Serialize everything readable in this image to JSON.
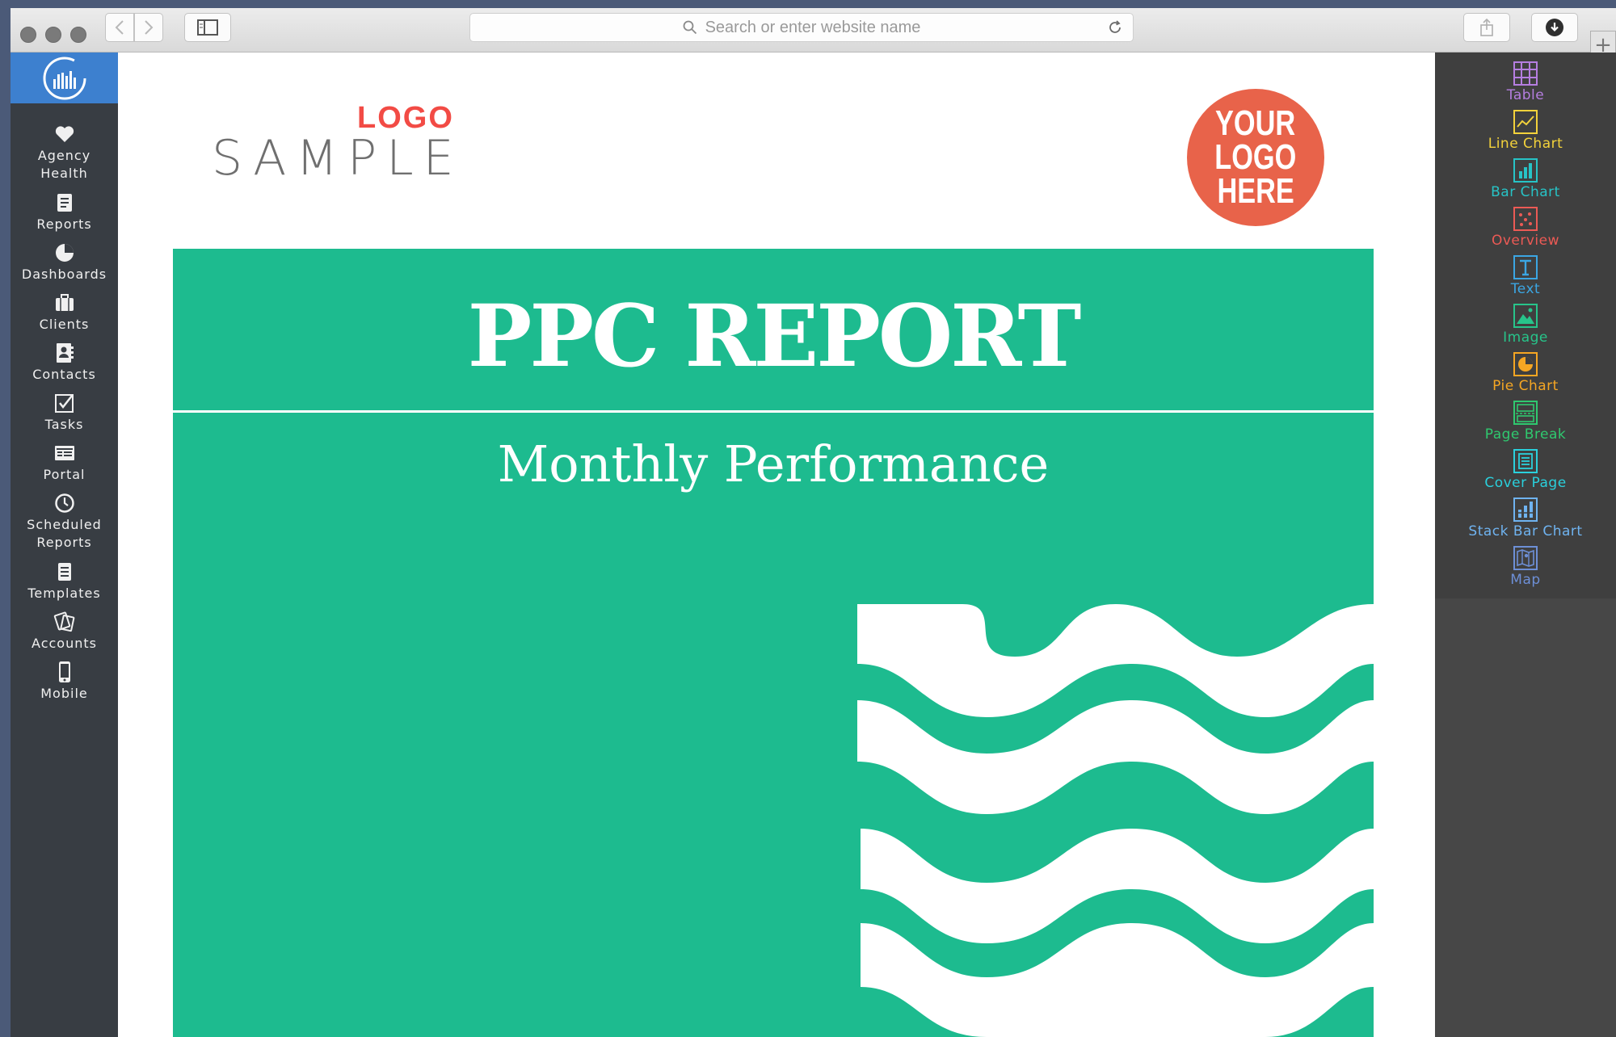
{
  "browser": {
    "address_placeholder": "Search or enter website name"
  },
  "sidebar": {
    "items": [
      {
        "label": "Agency\nHealth",
        "icon": "heart-icon"
      },
      {
        "label": "Reports",
        "icon": "reports-icon"
      },
      {
        "label": "Dashboards",
        "icon": "dashboards-icon"
      },
      {
        "label": "Clients",
        "icon": "briefcase-icon"
      },
      {
        "label": "Contacts",
        "icon": "contacts-icon"
      },
      {
        "label": "Tasks",
        "icon": "checkbox-icon"
      },
      {
        "label": "Portal",
        "icon": "portal-icon"
      },
      {
        "label": "Scheduled\nReports",
        "icon": "clock-icon"
      },
      {
        "label": "Templates",
        "icon": "templates-icon"
      },
      {
        "label": "Accounts",
        "icon": "accounts-icon"
      },
      {
        "label": "Mobile",
        "icon": "mobile-icon"
      }
    ]
  },
  "report": {
    "logo_top": "LOGO",
    "logo_bottom": "SAMPLE",
    "badge_lines": [
      "YOUR",
      "LOGO",
      "HERE"
    ],
    "title": "PPC REPORT",
    "subtitle": "Monthly Performance"
  },
  "widgets": [
    {
      "label": "Table",
      "icon": "table-icon",
      "color": "#b57ee0"
    },
    {
      "label": "Line Chart",
      "icon": "line-chart-icon",
      "color": "#f3d23b"
    },
    {
      "label": "Bar Chart",
      "icon": "bar-chart-icon",
      "color": "#27c3c6"
    },
    {
      "label": "Overview",
      "icon": "overview-icon",
      "color": "#ec5a55"
    },
    {
      "label": "Text",
      "icon": "text-icon",
      "color": "#3ba6e3"
    },
    {
      "label": "Image",
      "icon": "image-icon",
      "color": "#27c48a"
    },
    {
      "label": "Pie Chart",
      "icon": "pie-chart-icon",
      "color": "#f5a623"
    },
    {
      "label": "Page Break",
      "icon": "page-break-icon",
      "color": "#2fc96f"
    },
    {
      "label": "Cover Page",
      "icon": "cover-page-icon",
      "color": "#2ad0dc"
    },
    {
      "label": "Stack Bar Chart",
      "icon": "stack-bar-chart-icon",
      "color": "#6fb3f0"
    },
    {
      "label": "Map",
      "icon": "map-icon",
      "color": "#6d8fd6"
    }
  ],
  "colors": {
    "cover_green": "#1dbb8f",
    "badge_orange": "#e8634a",
    "logo_red": "#f24b45",
    "sidebar_bg": "#383d43",
    "sidebar_logo_blue": "#3d80cf"
  }
}
